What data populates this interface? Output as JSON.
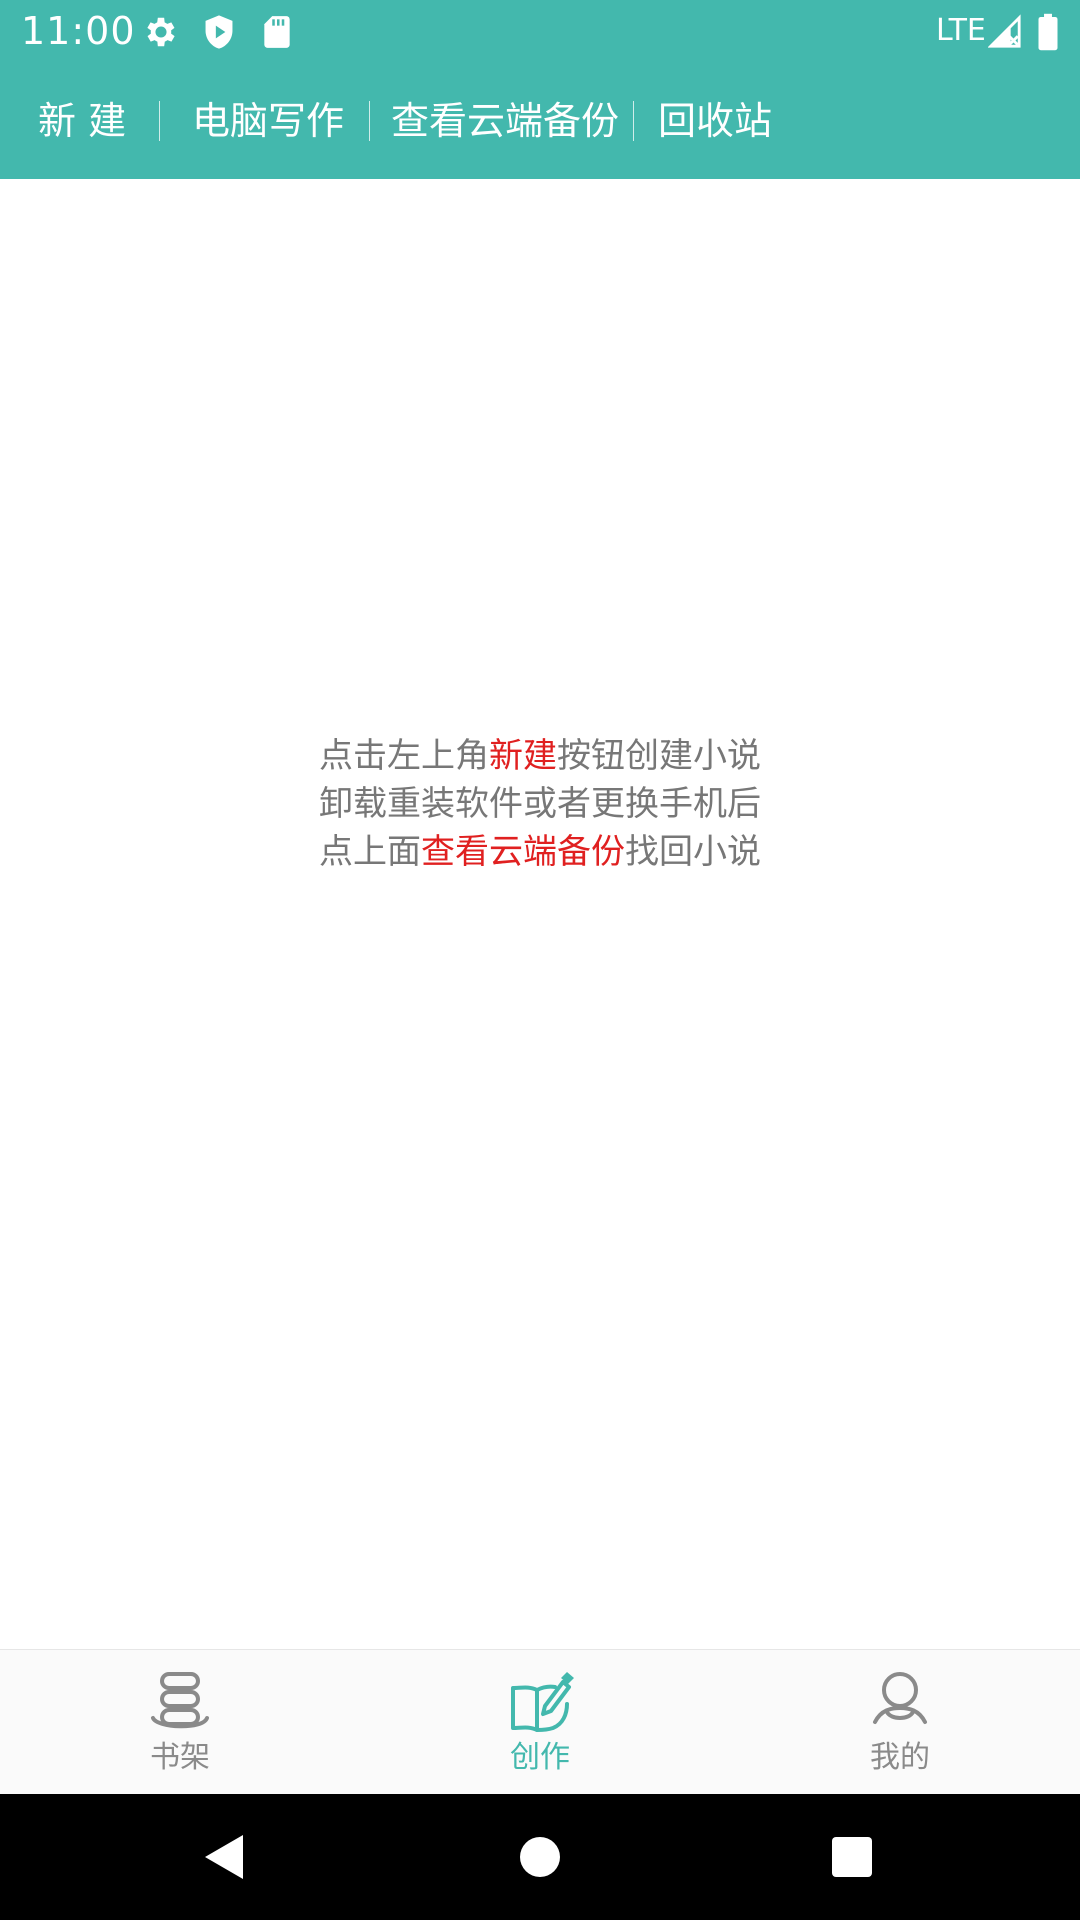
{
  "status_bar": {
    "time": "11:00",
    "network": "LTE",
    "icons": [
      "settings-gear-icon",
      "play-protect-icon",
      "sd-card-icon",
      "signal-icon",
      "battery-icon"
    ]
  },
  "toolbar": {
    "new_label": "新 建",
    "pc_writing_label": "电脑写作",
    "cloud_backup_label": "查看云端备份",
    "recycle_bin_label": "回收站"
  },
  "hint": {
    "line1_before": "点击左上角",
    "line1_highlight": "新建",
    "line1_after": "按钮创建小说",
    "line2": "卸载重装软件或者更换手机后",
    "line3_before": "点上面",
    "line3_highlight": "查看云端备份",
    "line3_after": "找回小说"
  },
  "bottom_nav": {
    "items": [
      {
        "label": "书架",
        "icon": "bookshelf-icon",
        "active": false
      },
      {
        "label": "创作",
        "icon": "write-icon",
        "active": true
      },
      {
        "label": "我的",
        "icon": "profile-icon",
        "active": false
      }
    ]
  },
  "system_nav": {
    "buttons": [
      "back-icon",
      "home-icon",
      "recents-icon"
    ]
  },
  "colors": {
    "accent": "#43b8ad",
    "highlight": "#e02020",
    "text_gray": "#777777",
    "nav_inactive": "#8a8a8a"
  }
}
